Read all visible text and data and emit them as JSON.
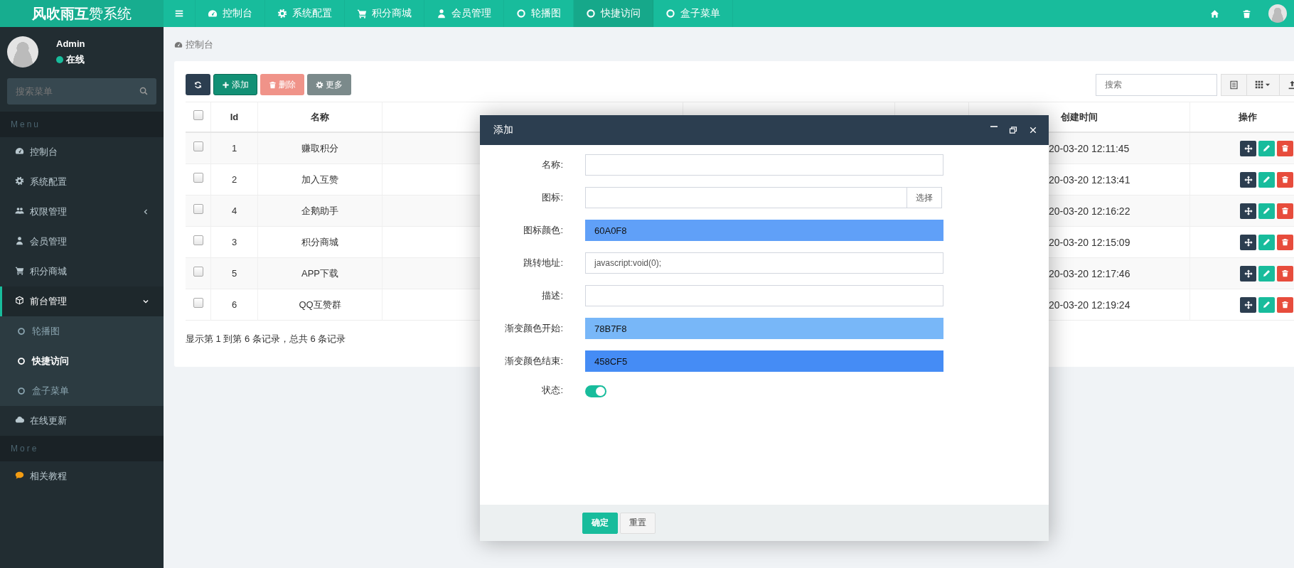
{
  "logo": "**风吹雨互**赞系统",
  "top_nav": [
    {
      "kind": "gauge",
      "label": "控制台",
      "selected": false
    },
    {
      "kind": "gear",
      "label": "系统配置",
      "selected": false
    },
    {
      "kind": "cart",
      "label": "积分商城",
      "selected": false
    },
    {
      "kind": "user",
      "label": "会员管理",
      "selected": false
    },
    {
      "kind": "ring",
      "label": "轮播图",
      "selected": false
    },
    {
      "kind": "ring",
      "label": "快捷访问",
      "selected": true
    },
    {
      "kind": "ring",
      "label": "盒子菜单",
      "selected": false
    }
  ],
  "user": {
    "name": "Admin",
    "status": "在线",
    "online": true
  },
  "sidebar_search": {
    "placeholder": "搜索菜单"
  },
  "sidebar": [
    {
      "header": "Menu",
      "items": [
        {
          "kind": "gauge",
          "label": "控制台",
          "selected": false
        },
        {
          "kind": "gear",
          "label": "系统配置",
          "selected": false
        },
        {
          "kind": "users",
          "label": "权限管理",
          "selected": false,
          "expanded": false
        },
        {
          "kind": "user",
          "label": "会员管理",
          "selected": false
        },
        {
          "kind": "cart",
          "label": "积分商城",
          "selected": false
        },
        {
          "kind": "cube",
          "label": "前台管理",
          "selected": false,
          "expanded": true,
          "children": [
            {
              "label": "轮播图",
              "selected": false
            },
            {
              "label": "快捷访问",
              "selected": true
            },
            {
              "label": "盒子菜单",
              "selected": false
            }
          ]
        },
        {
          "kind": "cloud",
          "label": "在线更新",
          "selected": false
        }
      ]
    },
    {
      "header": "More",
      "items": [
        {
          "kind": "chat",
          "label": "相关教程",
          "selected": false
        }
      ]
    }
  ],
  "breadcrumb": "控制台",
  "toolbar": [
    {
      "kind": "refresh",
      "disabled": false
    },
    {
      "kind": "add",
      "label": "添加",
      "disabled": false
    },
    {
      "kind": "delete",
      "label": "删除",
      "disabled": true
    },
    {
      "kind": "more",
      "label": "更多",
      "disabled": false
    }
  ],
  "table_search": {
    "placeholder": "搜索"
  },
  "table": {
    "select_all": {
      "checked": false
    },
    "columns": [
      "Id",
      "名称",
      "创建时间",
      "操作"
    ],
    "rows": [
      {
        "checked": false,
        "id": "1",
        "name": "赚取积分",
        "created": "20-03-20 12:11:45"
      },
      {
        "checked": false,
        "id": "2",
        "name": "加入互赞",
        "created": "20-03-20 12:13:41"
      },
      {
        "checked": false,
        "id": "4",
        "name": "企鹅助手",
        "created": "20-03-20 12:16:22"
      },
      {
        "checked": false,
        "id": "3",
        "name": "积分商城",
        "created": "20-03-20 12:15:09"
      },
      {
        "checked": false,
        "id": "5",
        "name": "APP下载",
        "created": "20-03-20 12:17:46"
      },
      {
        "checked": false,
        "id": "6",
        "name": "QQ互赞群",
        "created": "20-03-20 12:19:24"
      }
    ]
  },
  "pagination": "显示第 1 到第 6 条记录，总共 6 条记录",
  "dialog": {
    "title": "添加",
    "fields": [
      {
        "kind": "text",
        "label": "名称:"
      },
      {
        "kind": "picker",
        "label": "图标:",
        "button": "选择"
      },
      {
        "kind": "color",
        "label": "图标颜色:",
        "value": "60A0F8",
        "color": "#60a0f8"
      },
      {
        "kind": "text",
        "label": "跳转地址:",
        "value": "javascript:void(0);"
      },
      {
        "kind": "text",
        "label": "描述:"
      },
      {
        "kind": "color",
        "label": "渐变颜色开始:",
        "value": "78B7F8",
        "color": "#78b7f8"
      },
      {
        "kind": "color",
        "label": "渐变颜色结束:",
        "value": "458CF5",
        "color": "#458cf5"
      }
    ],
    "status": {
      "label": "状态:",
      "on": true
    },
    "buttons": [
      {
        "kind": "primary",
        "label": "确定"
      },
      {
        "kind": "default",
        "label": "重置"
      }
    ]
  }
}
